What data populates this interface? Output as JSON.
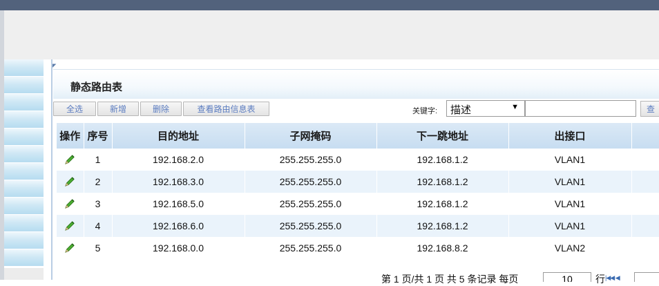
{
  "panel": {
    "title": "静态路由表"
  },
  "toolbar": {
    "select_all": "全选",
    "add": "新增",
    "delete": "删除",
    "view_route_info": "查看路由信息表",
    "keyword_label": "关键字:",
    "keyword_select_value": "描述",
    "keyword_input_value": "",
    "search_button": "查"
  },
  "table": {
    "headers": [
      "操作",
      "序号",
      "目的地址",
      "子网掩码",
      "下一跳地址",
      "出接口"
    ],
    "rows": [
      {
        "index": "1",
        "dest": "192.168.2.0",
        "mask": "255.255.255.0",
        "next_hop": "192.168.1.2",
        "iface": "VLAN1"
      },
      {
        "index": "2",
        "dest": "192.168.3.0",
        "mask": "255.255.255.0",
        "next_hop": "192.168.1.2",
        "iface": "VLAN1"
      },
      {
        "index": "3",
        "dest": "192.168.5.0",
        "mask": "255.255.255.0",
        "next_hop": "192.168.1.2",
        "iface": "VLAN1"
      },
      {
        "index": "4",
        "dest": "192.168.6.0",
        "mask": "255.255.255.0",
        "next_hop": "192.168.1.2",
        "iface": "VLAN1"
      },
      {
        "index": "5",
        "dest": "192.168.0.0",
        "mask": "255.255.255.0",
        "next_hop": "192.168.8.2",
        "iface": "VLAN2"
      }
    ]
  },
  "footer": {
    "summary": "第 1 页/共 1 页 共 5 条记录 每页",
    "page_size": "10",
    "rows_label": "行"
  },
  "icons": {
    "edit": "pencil-icon",
    "first_page": "first-page-icon",
    "prev_page": "prev-page-icon"
  },
  "colors": {
    "header_bar": "#52627c",
    "table_header": "#c7ddf1",
    "row_alt": "#eaf3fb",
    "button_text": "#5b7cc0",
    "pencil": "#3a9a2a"
  }
}
